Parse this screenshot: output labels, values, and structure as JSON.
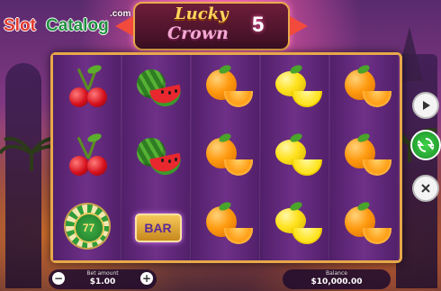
{
  "watermark": {
    "part1": "Slot",
    "part2": "Catalog",
    "suffix": ".com"
  },
  "game_title": {
    "line1": "Lucky",
    "line2": "Crown",
    "number": "5"
  },
  "reels": [
    [
      "cherry",
      "cherry",
      "chip"
    ],
    [
      "watermelon",
      "watermelon",
      "bar"
    ],
    [
      "orange",
      "orange",
      "orange"
    ],
    [
      "lemon",
      "lemon",
      "lemon"
    ],
    [
      "orange",
      "orange",
      "orange"
    ]
  ],
  "symbol_labels": {
    "chip": "77",
    "bar": "BAR"
  },
  "side_controls": {
    "play_icon": "play-icon",
    "spin_icon": "spin-icon",
    "autoplay_icon": "autoplay-icon"
  },
  "bottom": {
    "bet_label": "Bet amount",
    "bet_value": "$1.00",
    "minus": "−",
    "plus": "+",
    "balance_label": "Balance",
    "balance_value": "$10,000.00"
  },
  "colors": {
    "frame_gold": "#e7a84a",
    "reel_purple": "#6b2d7e",
    "spin_green": "#2cb83a"
  }
}
